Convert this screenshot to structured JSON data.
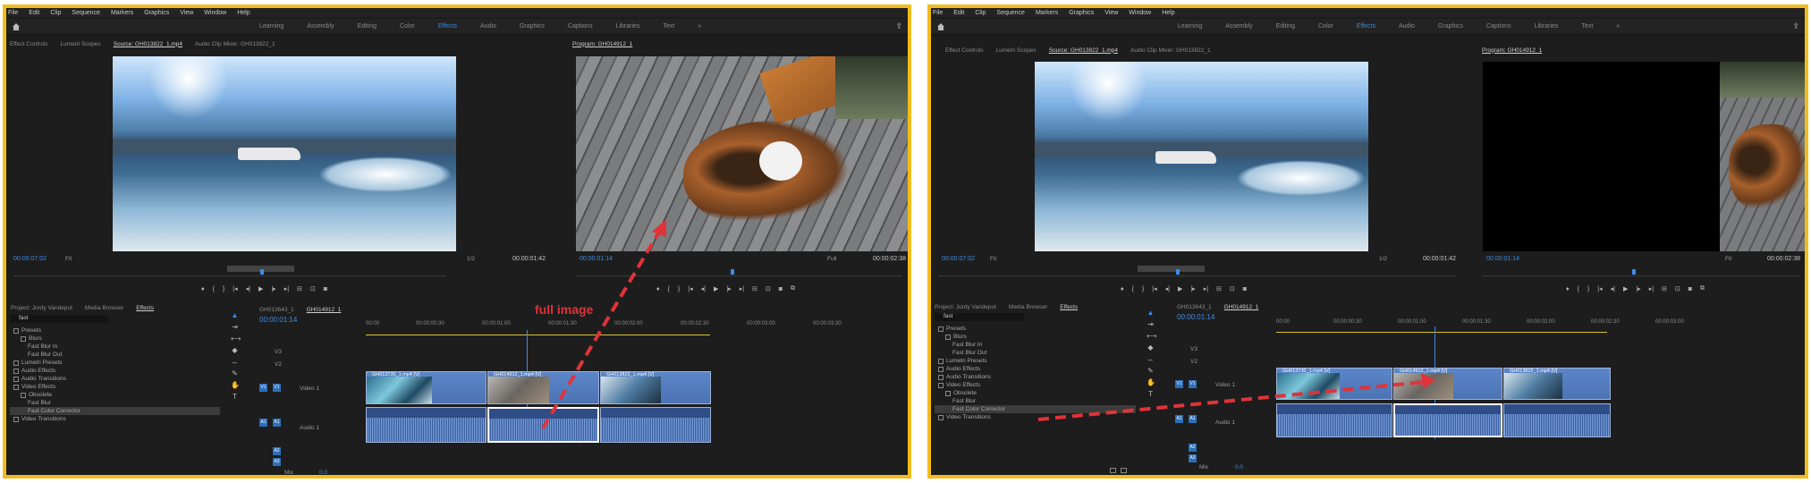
{
  "left": {
    "menu": [
      "File",
      "Edit",
      "Clip",
      "Sequence",
      "Markers",
      "Graphics",
      "View",
      "Window",
      "Help"
    ],
    "workspaces": [
      "Learning",
      "Assembly",
      "Editing",
      "Color",
      "Effects",
      "Audio",
      "Graphics",
      "Captions",
      "Libraries",
      "Text"
    ],
    "active_workspace": "Effects",
    "source_tabs": [
      "Effect Controls",
      "Lumetri Scopes",
      "Source: GH013822_1.mp4",
      "Audio Clip Mixer: GH013822_1"
    ],
    "program_title": "Program: GH014912_1",
    "source_tc": "00:00:07:02",
    "source_fit": "Fit",
    "source_ratio": "1/2",
    "source_dur": "00:00:01:42",
    "program_tc": "00:00:01:14",
    "program_fit": "Full",
    "program_dur": "00:00:02:38",
    "project_tabs": [
      "Project: Jordy Vandeput",
      "Media Browser",
      "Effects"
    ],
    "search_value": "fast",
    "tree": [
      "Presets",
      "Blurs",
      "Fast Blur In",
      "Fast Blur Out",
      "Lumetri Presets",
      "Audio Effects",
      "Audio Transitions",
      "Video Effects",
      "Obsolete",
      "Fast Blur",
      "Fast Color Corrector",
      "Video Transitions"
    ],
    "seq_tabs": [
      "GH013643_1",
      "GH014912_1"
    ],
    "seq_tc": "00:00:01:14",
    "ruler": [
      "00:00",
      "00:00:00:30",
      "00:00:01:00",
      "00:00:01:30",
      "00:00:02:00",
      "00:00:02:30",
      "00:00:03:00",
      "00:00:03:30"
    ],
    "tracks_v": [
      "V3",
      "V2",
      "V1"
    ],
    "tracks_a": [
      "A1",
      "A2",
      "A3"
    ],
    "video_label": "Video 1",
    "audio_label": "Audio 1",
    "mix_label": "Mix",
    "mix_value": "0.0",
    "clips": [
      "GH013730_1.mp4 [V]",
      "GH014912_1.mp4 [V]",
      "GH013822_1.mp4 [V]"
    ],
    "annotation": "full image"
  },
  "right": {
    "menu": [
      "File",
      "Edit",
      "Clip",
      "Sequence",
      "Markers",
      "Graphics",
      "View",
      "Window",
      "Help"
    ],
    "workspaces": [
      "Learning",
      "Assembly",
      "Editing",
      "Color",
      "Effects",
      "Audio",
      "Graphics",
      "Captions",
      "Libraries",
      "Text"
    ],
    "active_workspace": "Effects",
    "source_tabs": [
      "Effect Controls",
      "Lumetri Scopes",
      "Source: GH013822_1.mp4",
      "Audio Clip Mixer: GH013822_1"
    ],
    "program_title": "Program: GH014912_1",
    "source_tc": "00:00:07:02",
    "source_fit": "Fit",
    "source_ratio": "1/2",
    "source_dur": "00:00:01:42",
    "program_tc": "00:00:01:14",
    "program_fit": "Fit",
    "program_dur": "00:00:02:38",
    "project_tabs": [
      "Project: Jordy Vandeput",
      "Media Browser",
      "Effects"
    ],
    "search_value": "fast",
    "tree": [
      "Presets",
      "Blurs",
      "Fast Blur In",
      "Fast Blur Out",
      "Lumetri Presets",
      "Audio Effects",
      "Audio Transitions",
      "Video Effects",
      "Obsolete",
      "Fast Blur",
      "Fast Color Corrector",
      "Video Transitions"
    ],
    "seq_tabs": [
      "GH013643_1",
      "GH014912_1"
    ],
    "seq_tc": "00:00:01:14",
    "ruler": [
      "00:00",
      "00:00:00:30",
      "00:00:01:00",
      "00:00:01:30",
      "00:00:02:00",
      "00:00:02:30",
      "00:00:03:00"
    ],
    "tracks_v": [
      "V3",
      "V2",
      "V1"
    ],
    "tracks_a": [
      "A1",
      "A2",
      "A3"
    ],
    "video_label": "Video 1",
    "audio_label": "Audio 1",
    "mix_label": "Mix",
    "mix_value": "0.0",
    "clips": [
      "GH013730_1.mp4 [V]",
      "GH014912_1.mp4 [V]",
      "GH013822_1.mp4 [V]"
    ]
  },
  "colors": {
    "frame_border": "#f2bc1c",
    "accent": "#2d8ceb",
    "arrow": "#e0333a",
    "clip": "#5b86c9"
  }
}
